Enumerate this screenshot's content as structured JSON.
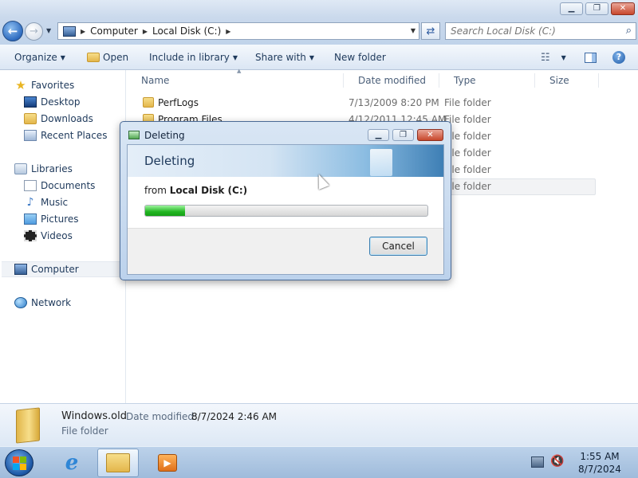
{
  "window": {
    "minimize_glyph": "▁",
    "restore_glyph": "❐",
    "close_glyph": "✕"
  },
  "address": {
    "crumbs": [
      "Computer",
      "Local Disk (C:)"
    ],
    "search_placeholder": "Search Local Disk (C:)"
  },
  "toolbar": {
    "organize": "Organize",
    "open": "Open",
    "include": "Include in library",
    "share": "Share with",
    "new_folder": "New folder"
  },
  "nav": {
    "favorites": "Favorites",
    "desktop": "Desktop",
    "downloads": "Downloads",
    "recent": "Recent Places",
    "libraries": "Libraries",
    "documents": "Documents",
    "music": "Music",
    "pictures": "Pictures",
    "videos": "Videos",
    "computer": "Computer",
    "network": "Network"
  },
  "columns": {
    "name": "Name",
    "date": "Date modified",
    "type": "Type",
    "size": "Size"
  },
  "files": [
    {
      "name": "PerfLogs",
      "date": "7/13/2009 8:20 PM",
      "type": "File folder"
    },
    {
      "name": "Program Files",
      "date": "4/12/2011 12:45 AM",
      "type": "File folder"
    },
    {
      "name": "",
      "date": "",
      "type": "File folder"
    },
    {
      "name": "",
      "date": "",
      "type": "File folder"
    },
    {
      "name": "",
      "date": "",
      "type": "File folder"
    },
    {
      "name": "",
      "date": "",
      "type": "File folder"
    }
  ],
  "details": {
    "name": "Windows.old",
    "date_label": "Date modified:",
    "date_value": "8/7/2024 2:46 AM",
    "type": "File folder"
  },
  "dialog": {
    "title": "Deleting",
    "heading": "Deleting",
    "from_prefix": "from",
    "from_location": "Local Disk (C:)",
    "progress": 0.14,
    "cancel": "Cancel"
  },
  "taskbar": {
    "time": "1:55 AM",
    "date": "8/7/2024"
  },
  "colors": {
    "progress_green": "#21b521",
    "accent_blue": "#1e395b",
    "close_red": "#c7472c"
  }
}
